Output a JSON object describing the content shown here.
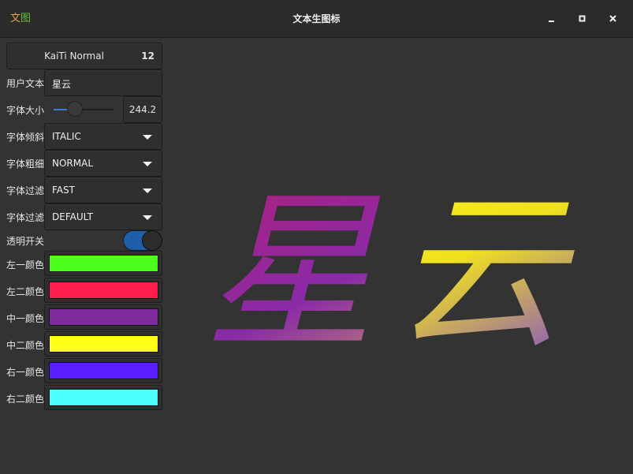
{
  "window": {
    "title": "文本生图标",
    "icon_chars": [
      "文",
      "图"
    ]
  },
  "font_button": {
    "name": "KaiTi Normal",
    "size": "12"
  },
  "user_text": {
    "label": "用户文本",
    "value": "星云"
  },
  "font_size": {
    "label": "字体大小",
    "value": "244.2",
    "slider_fraction": 0.25
  },
  "font_posture": {
    "label": "字体倾斜",
    "value": "ITALIC"
  },
  "font_weight": {
    "label": "字体粗细",
    "value": "NORMAL"
  },
  "font_filter1": {
    "label": "字体过滤",
    "value": "FAST"
  },
  "font_filter2": {
    "label": "字体过滤",
    "value": "DEFAULT"
  },
  "transparent": {
    "label": "透明开关",
    "on": true
  },
  "colors": [
    {
      "label": "左一颜色",
      "hex": "#4dff1f"
    },
    {
      "label": "左二颜色",
      "hex": "#ff1f4d"
    },
    {
      "label": "中一颜色",
      "hex": "#7d2a9c"
    },
    {
      "label": "中二颜色",
      "hex": "#ffff1a"
    },
    {
      "label": "右一颜色",
      "hex": "#5a1fff"
    },
    {
      "label": "右二颜色",
      "hex": "#4dffff"
    }
  ],
  "preview": {
    "text": "星云"
  }
}
